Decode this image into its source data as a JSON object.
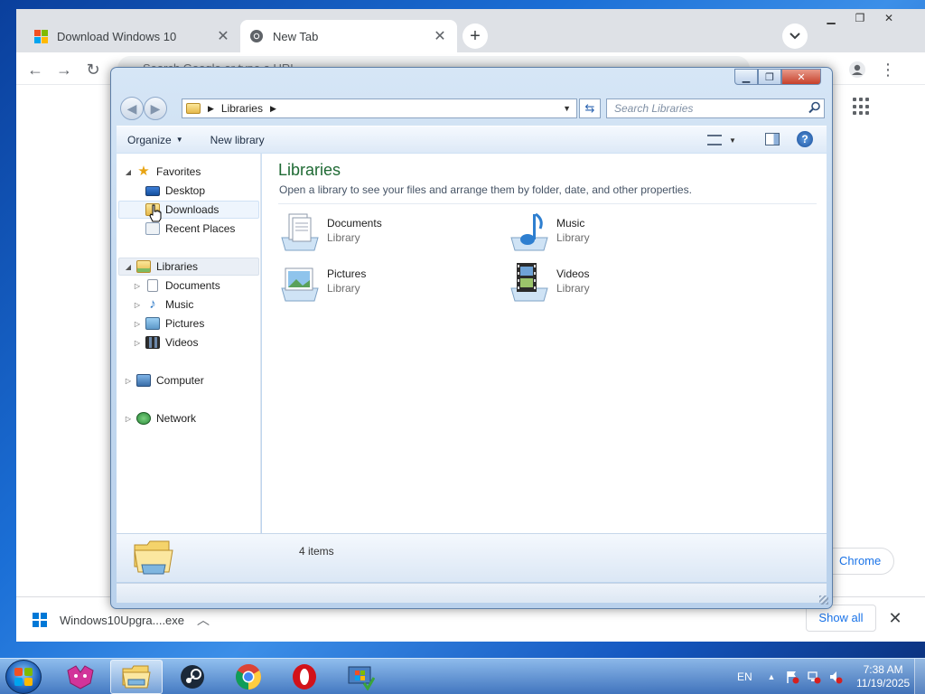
{
  "browser": {
    "tabs": [
      {
        "title": "Download Windows 10"
      },
      {
        "title": "New Tab"
      }
    ],
    "omnibox_placeholder": "Search Google or type a URL",
    "make_default_label": "Chrome",
    "download_bar": {
      "file_name": "Windows10Upgra....exe",
      "show_all_label": "Show all"
    }
  },
  "explorer": {
    "breadcrumb": [
      "Libraries"
    ],
    "search_placeholder": "Search Libraries",
    "command_bar": {
      "organize_label": "Organize",
      "new_library_label": "New library"
    },
    "nav_tree": {
      "favorites": {
        "label": "Favorites",
        "children": [
          "Desktop",
          "Downloads",
          "Recent Places"
        ]
      },
      "libraries": {
        "label": "Libraries",
        "children": [
          "Documents",
          "Music",
          "Pictures",
          "Videos"
        ]
      },
      "computer_label": "Computer",
      "network_label": "Network"
    },
    "content": {
      "title": "Libraries",
      "subtitle": "Open a library to see your files and arrange them by folder, date, and other properties.",
      "items": [
        {
          "name": "Documents",
          "type": "Library",
          "icon": "documents-library-icon"
        },
        {
          "name": "Music",
          "type": "Library",
          "icon": "music-library-icon"
        },
        {
          "name": "Pictures",
          "type": "Library",
          "icon": "pictures-library-icon"
        },
        {
          "name": "Videos",
          "type": "Library",
          "icon": "videos-library-icon"
        }
      ]
    },
    "details": {
      "item_count": "4 items"
    }
  },
  "taskbar": {
    "pinned": [
      "paint-app-icon",
      "file-explorer-icon",
      "steam-icon",
      "chrome-icon",
      "opera-icon",
      "windows-update-icon"
    ],
    "active": "file-explorer-icon"
  },
  "tray": {
    "language": "EN",
    "time": "7:38 AM",
    "date": "11/19/2025"
  },
  "colors": {
    "explorer_title_accent": "#1f6a34",
    "chrome_link": "#1a73e8",
    "windows_logo": [
      "#f25022",
      "#7fba00",
      "#00a4ef",
      "#ffb900"
    ]
  }
}
